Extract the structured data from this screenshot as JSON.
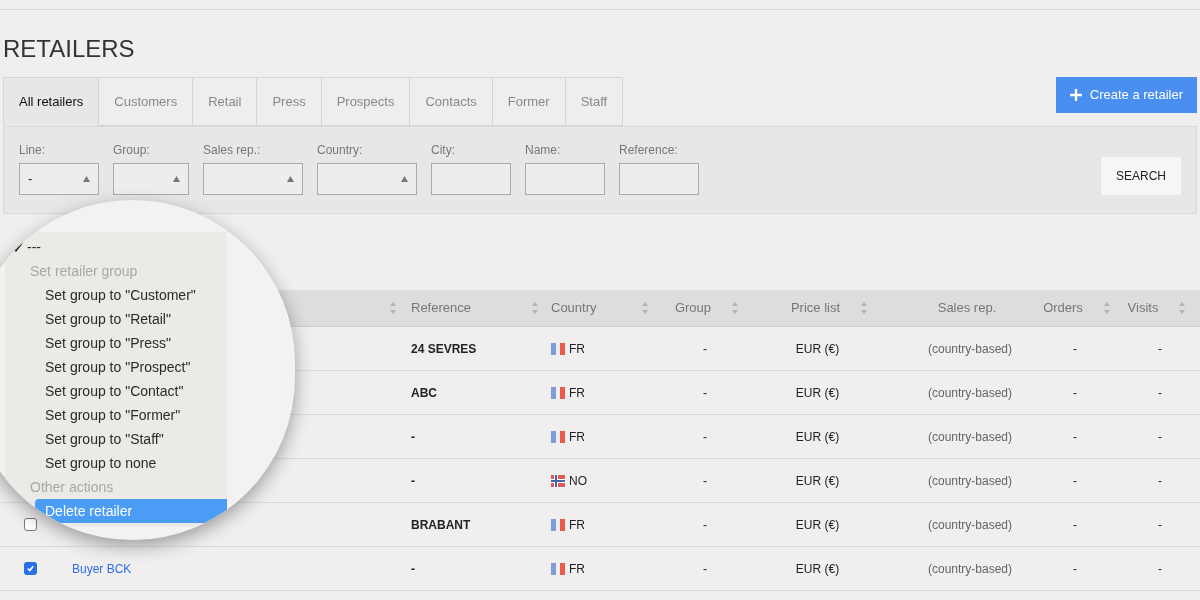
{
  "page_title": "RETAILERS",
  "tabs": [
    {
      "label": "All retailers",
      "selected": true
    },
    {
      "label": "Customers",
      "selected": false
    },
    {
      "label": "Retail",
      "selected": false
    },
    {
      "label": "Press",
      "selected": false
    },
    {
      "label": "Prospects",
      "selected": false
    },
    {
      "label": "Contacts",
      "selected": false
    },
    {
      "label": "Former",
      "selected": false
    },
    {
      "label": "Staff",
      "selected": false
    }
  ],
  "create_button": "Create a retailer",
  "filters": [
    {
      "label": "Line:",
      "kind": "select",
      "value": "-"
    },
    {
      "label": "Group:",
      "kind": "select"
    },
    {
      "label": "Sales rep.:",
      "kind": "select"
    },
    {
      "label": "Country:",
      "kind": "select"
    },
    {
      "label": "City:",
      "kind": "text"
    },
    {
      "label": "Name:",
      "kind": "text"
    },
    {
      "label": "Reference:",
      "kind": "text"
    }
  ],
  "search_button": "SEARCH",
  "table": {
    "columns": [
      {
        "label": "Reference",
        "sortable": true
      },
      {
        "label": "Country",
        "sortable": true
      },
      {
        "label": "Group",
        "sortable": true
      },
      {
        "label": "Price list",
        "sortable": true
      },
      {
        "label": "Sales rep.",
        "sortable": false
      },
      {
        "label": "Orders",
        "sortable": true
      },
      {
        "label": "Visits",
        "sortable": true
      }
    ],
    "rows": [
      {
        "reference": "24 SEVRES",
        "kind": "fr",
        "country": "FR",
        "group": "-",
        "price_list": "EUR (€)",
        "sales_rep": "(country-based)",
        "orders": "-",
        "visits": "-"
      },
      {
        "reference": "ABC",
        "kind": "fr",
        "country": "FR",
        "group": "-",
        "price_list": "EUR (€)",
        "sales_rep": "(country-based)",
        "orders": "-",
        "visits": "-"
      },
      {
        "reference": "-",
        "kind": "fr",
        "country": "FR",
        "group": "-",
        "price_list": "EUR (€)",
        "sales_rep": "(country-based)",
        "orders": "-",
        "visits": "-"
      },
      {
        "reference": "-",
        "kind": "no",
        "country": "NO",
        "group": "-",
        "price_list": "EUR (€)",
        "sales_rep": "(country-based)",
        "orders": "-",
        "visits": "-"
      },
      {
        "checked": false,
        "reference": "BRABANT",
        "kind": "fr",
        "country": "FR",
        "group": "-",
        "price_list": "EUR (€)",
        "sales_rep": "(country-based)",
        "orders": "-",
        "visits": "-"
      },
      {
        "checked": true,
        "name": "Buyer BCK",
        "reference": "-",
        "kind": "fr",
        "country": "FR",
        "group": "-",
        "price_list": "EUR (€)",
        "sales_rep": "(country-based)",
        "orders": "-",
        "visits": "-"
      }
    ]
  },
  "bulk_menu": [
    {
      "kind": "option",
      "label": "---",
      "selected": true,
      "highlighted": false
    },
    {
      "kind": "header",
      "label": "Set retailer group",
      "children": [
        {
          "label": "Set group to \"Customer\"",
          "selected": false,
          "highlighted": false
        },
        {
          "label": "Set group to \"Retail\"",
          "selected": false,
          "highlighted": false
        },
        {
          "label": "Set group to \"Press\"",
          "selected": false,
          "highlighted": false
        },
        {
          "label": "Set group to \"Prospect\"",
          "selected": false,
          "highlighted": false
        },
        {
          "label": "Set group to \"Contact\"",
          "selected": false,
          "highlighted": false
        },
        {
          "label": "Set group to \"Former\"",
          "selected": false,
          "highlighted": false
        },
        {
          "label": "Set group to \"Staff\"",
          "selected": false,
          "highlighted": false
        },
        {
          "label": "Set group to none",
          "selected": false,
          "highlighted": false
        }
      ]
    },
    {
      "kind": "header",
      "label": "Other actions",
      "children": [
        {
          "label": "Delete retailer",
          "selected": false,
          "highlighted": true
        }
      ]
    }
  ]
}
